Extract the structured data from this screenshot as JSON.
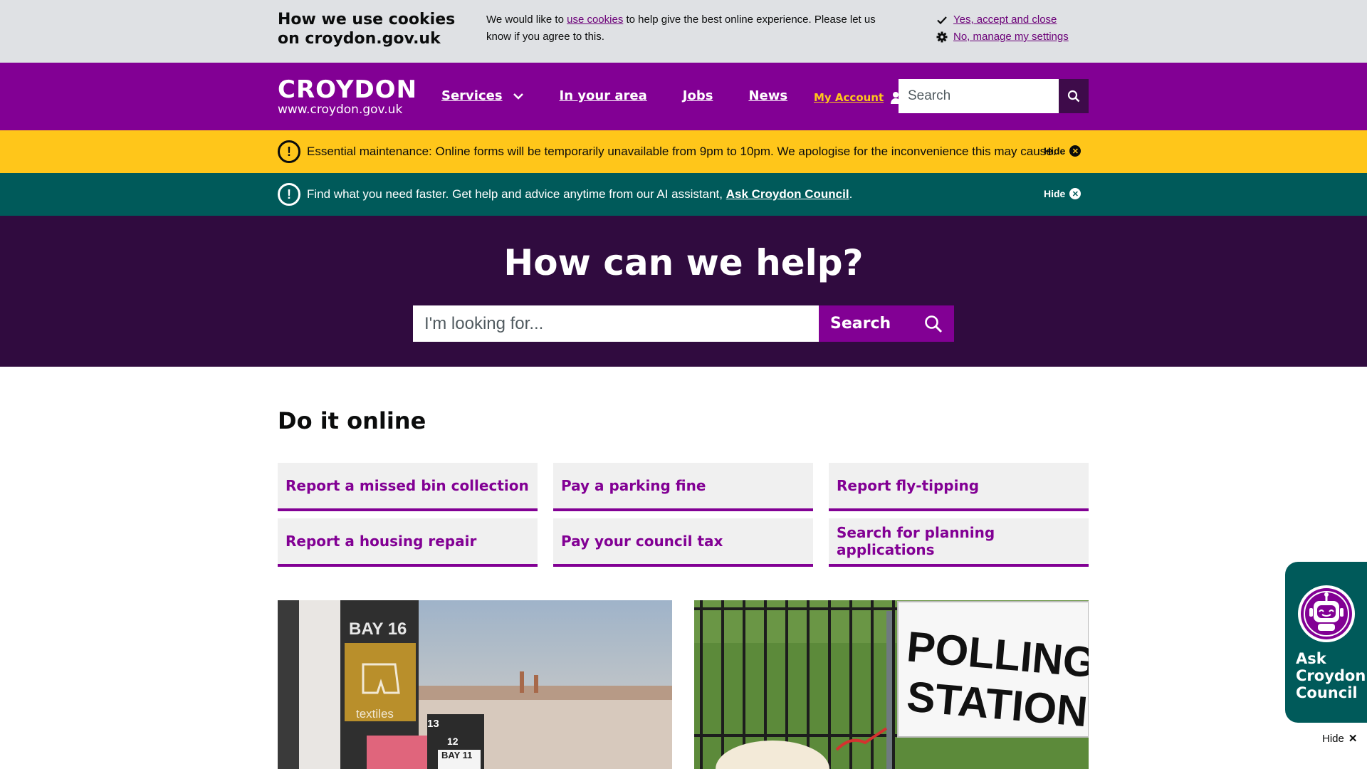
{
  "cookie_banner": {
    "title": "How we use cookies on croydon.gov.uk",
    "text_before": "We would like to ",
    "link": "use cookies",
    "text_after": " to help give the best online experience. Please let us know if you agree to this.",
    "accept": "Yes, accept and close",
    "manage": "No, manage my settings"
  },
  "header": {
    "logo_title": "CROYDON",
    "logo_url": "www.croydon.gov.uk",
    "nav": [
      "Services",
      "In your area",
      "Jobs",
      "News"
    ],
    "account": "My Account",
    "search_placeholder": "Search"
  },
  "alerts": {
    "maintenance": "Essential maintenance: Online forms will be temporarily unavailable from 9pm to 10pm. We apologise for the inconvenience this may cause.",
    "assistant_before": "Find what you need faster. Get help and advice anytime from our AI assistant, ",
    "assistant_link": "Ask Croydon Council",
    "assistant_after": ".",
    "hide": "Hide"
  },
  "hero": {
    "title": "How can we help?",
    "placeholder": "I'm looking for...",
    "button": "Search"
  },
  "do_it_online": {
    "title": "Do it online",
    "tiles": [
      "Report a missed bin collection",
      "Pay a parking fine",
      "Report fly-tipping",
      "Report a housing repair",
      "Pay your council tax",
      "Search for planning applications"
    ]
  },
  "photos": {
    "left_sign": "BAY 16",
    "left_sub": "textiles",
    "left_bays": [
      "13",
      "12",
      "BAY 11"
    ],
    "right_sign_line1": "POLLING",
    "right_sign_line2": "STATION"
  },
  "assistant_widget": {
    "label_lines": [
      "Ask",
      "Croydon",
      "Council"
    ],
    "hide": "Hide"
  },
  "colors": {
    "brand_purple": "#820094",
    "dark_purple": "#300b3f",
    "alert_yellow": "#ffc61a",
    "alert_teal": "#005a5a"
  }
}
